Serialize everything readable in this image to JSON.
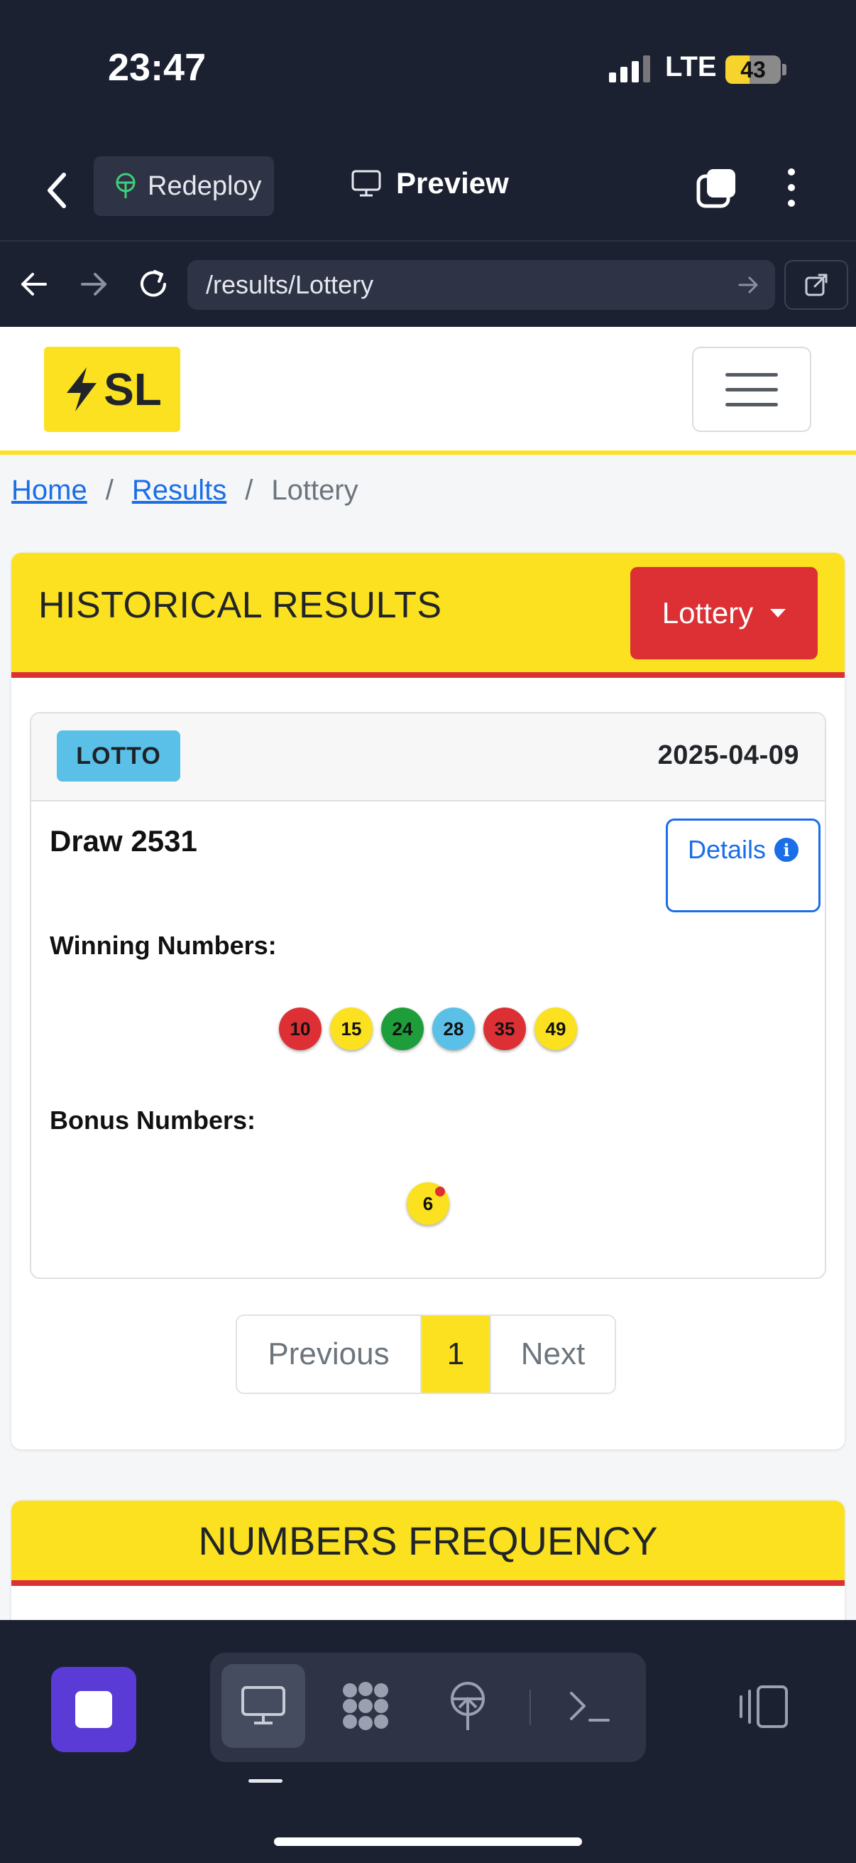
{
  "status_bar": {
    "time": "23:47",
    "network": "LTE",
    "battery": "43",
    "battery_fraction": 0.43
  },
  "app_toolbar": {
    "redeploy_label": "Redeploy",
    "preview_label": "Preview"
  },
  "url_bar": {
    "url": "/results/Lottery"
  },
  "site": {
    "brand_text": "SL",
    "breadcrumb": {
      "home": "Home",
      "results": "Results",
      "current": "Lottery",
      "separator": "/"
    }
  },
  "historical": {
    "title": "HISTORICAL RESULTS",
    "dropdown_label": "Lottery",
    "result": {
      "game_badge": "LOTTO",
      "date": "2025-04-09",
      "draw_title": "Draw 2531",
      "details_label": "Details",
      "winning_label": "Winning Numbers:",
      "winning_numbers": [
        {
          "n": "10",
          "color": "#dc3035"
        },
        {
          "n": "15",
          "color": "#fbe11f"
        },
        {
          "n": "24",
          "color": "#1e9e3a"
        },
        {
          "n": "28",
          "color": "#5bc0e8"
        },
        {
          "n": "35",
          "color": "#dc3035"
        },
        {
          "n": "49",
          "color": "#fbe11f"
        }
      ],
      "bonus_label": "Bonus Numbers:",
      "bonus_numbers": [
        {
          "n": "6",
          "color": "#fbe11f"
        }
      ]
    },
    "pagination": {
      "prev": "Previous",
      "current": "1",
      "next": "Next"
    }
  },
  "frequency": {
    "title": "NUMBERS FREQUENCY"
  },
  "colors": {
    "yellow": "#fbe11f",
    "red": "#dc3035",
    "link_blue": "#1a6ee8",
    "dark": "#1c2132",
    "purple": "#5b3bd6"
  }
}
